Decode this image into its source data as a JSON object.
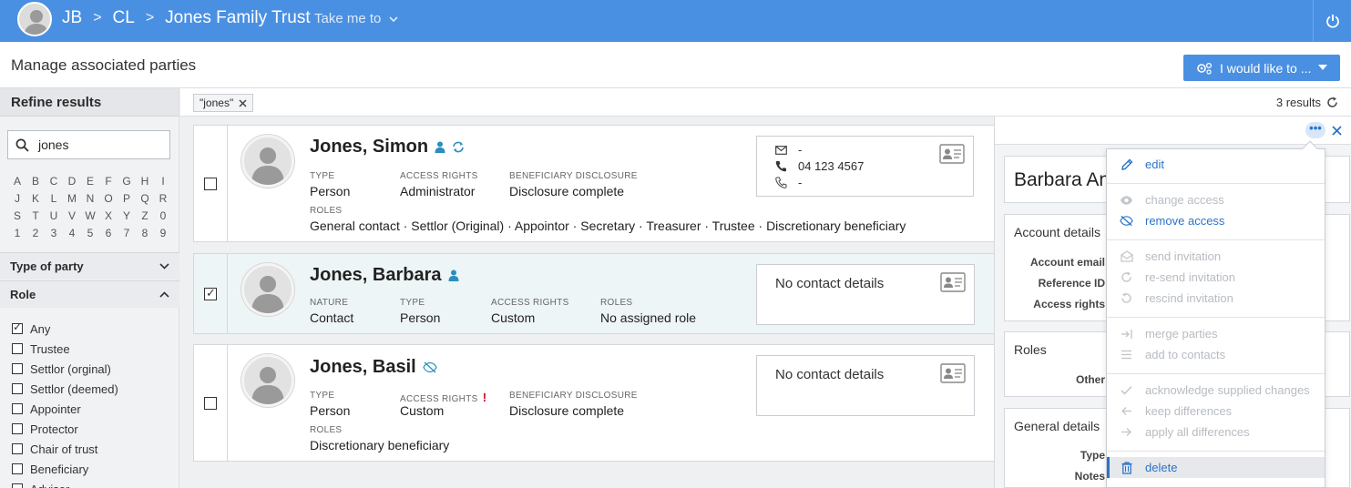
{
  "topbar": {
    "crumbs": [
      "JB",
      "CL",
      "Jones Family Trust"
    ],
    "crumb_separator": ">",
    "take_me_to": "Take me to",
    "color": "#4a90e2"
  },
  "header": {
    "title": "Manage associated parties",
    "action_button": "I would like to ..."
  },
  "sidebar": {
    "refine_title": "Refine results",
    "search_value": "jones",
    "alphabet": [
      "A",
      "B",
      "C",
      "D",
      "E",
      "F",
      "G",
      "H",
      "I",
      "J",
      "K",
      "L",
      "M",
      "N",
      "O",
      "P",
      "Q",
      "R",
      "S",
      "T",
      "U",
      "V",
      "W",
      "X",
      "Y",
      "Z",
      "0",
      "1",
      "2",
      "3",
      "4",
      "5",
      "6",
      "7",
      "8",
      "9"
    ],
    "facet_type": "Type of party",
    "facet_role": "Role",
    "role_options": [
      {
        "label": "Any",
        "checked": true
      },
      {
        "label": "Trustee",
        "checked": false
      },
      {
        "label": "Settlor (orginal)",
        "checked": false
      },
      {
        "label": "Settlor (deemed)",
        "checked": false
      },
      {
        "label": "Appointer",
        "checked": false
      },
      {
        "label": "Protector",
        "checked": false
      },
      {
        "label": "Chair of trust",
        "checked": false
      },
      {
        "label": "Beneficiary",
        "checked": false
      },
      {
        "label": "Advisor",
        "checked": false
      }
    ]
  },
  "results": {
    "filter_chip": "\"jones\"",
    "count_label": "3 results"
  },
  "parties": [
    {
      "name": "Jones, Simon",
      "selected": false,
      "type_label": "TYPE",
      "type": "Person",
      "access_label": "ACCESS RIGHTS",
      "access": "Administrator",
      "disclosure_label": "BENEFICIARY DISCLOSURE",
      "disclosure": "Disclosure complete",
      "roles_label": "ROLES",
      "roles": "General contact · Settlor (Original) · Appointor · Secretary · Treasurer · Trustee · Discretionary beneficiary",
      "contact_email": "-",
      "contact_phone": "04 123 4567",
      "contact_mobile": "-"
    },
    {
      "name": "Jones, Barbara",
      "selected": true,
      "nature_label": "NATURE",
      "nature": "Contact",
      "type_label": "TYPE",
      "type": "Person",
      "access_label": "ACCESS RIGHTS",
      "access": "Custom",
      "roles_label": "ROLES",
      "roles": "No assigned role",
      "contact": "No contact details"
    },
    {
      "name": "Jones, Basil",
      "selected": false,
      "type_label": "TYPE",
      "type": "Person",
      "access_label": "ACCESS RIGHTS",
      "access_flag": "!",
      "access": "Custom",
      "disclosure_label": "BENEFICIARY DISCLOSURE",
      "disclosure": "Disclosure complete",
      "roles_label": "ROLES",
      "roles": "Discretionary beneficiary",
      "contact": "No contact details"
    }
  ],
  "detail_panel": {
    "name": "Barbara An",
    "account_section": "Account details",
    "account_email_label": "Account email",
    "reference_label": "Reference ID",
    "access_label": "Access rights",
    "roles_section": "Roles",
    "roles_other_label": "Other",
    "general_section": "General details",
    "type_label": "Type",
    "notes_label": "Notes"
  },
  "menu": {
    "items": [
      {
        "label": "edit",
        "icon": "pencil-icon",
        "enabled": true
      },
      {
        "label": "change access",
        "icon": "eye-icon",
        "enabled": false
      },
      {
        "label": "remove access",
        "icon": "eye-slash-icon",
        "enabled": true
      },
      {
        "label": "send invitation",
        "icon": "envelope-icon",
        "enabled": false
      },
      {
        "label": "re-send invitation",
        "icon": "redo-icon",
        "enabled": false
      },
      {
        "label": "rescind invitation",
        "icon": "undo-icon",
        "enabled": false
      },
      {
        "label": "merge parties",
        "icon": "merge-icon",
        "enabled": false
      },
      {
        "label": "add to contacts",
        "icon": "list-icon",
        "enabled": false
      },
      {
        "label": "acknowledge supplied changes",
        "icon": "check-icon",
        "enabled": false
      },
      {
        "label": "keep differences",
        "icon": "arrow-left-icon",
        "enabled": false
      },
      {
        "label": "apply all differences",
        "icon": "arrow-right-icon",
        "enabled": false
      },
      {
        "label": "delete",
        "icon": "trash-icon",
        "enabled": true,
        "highlighted": true
      }
    ]
  },
  "colors": {
    "accent": "#4a90e2",
    "link": "#2a74c9",
    "disabled": "#b7bcc2",
    "warning": "#d0021b"
  }
}
